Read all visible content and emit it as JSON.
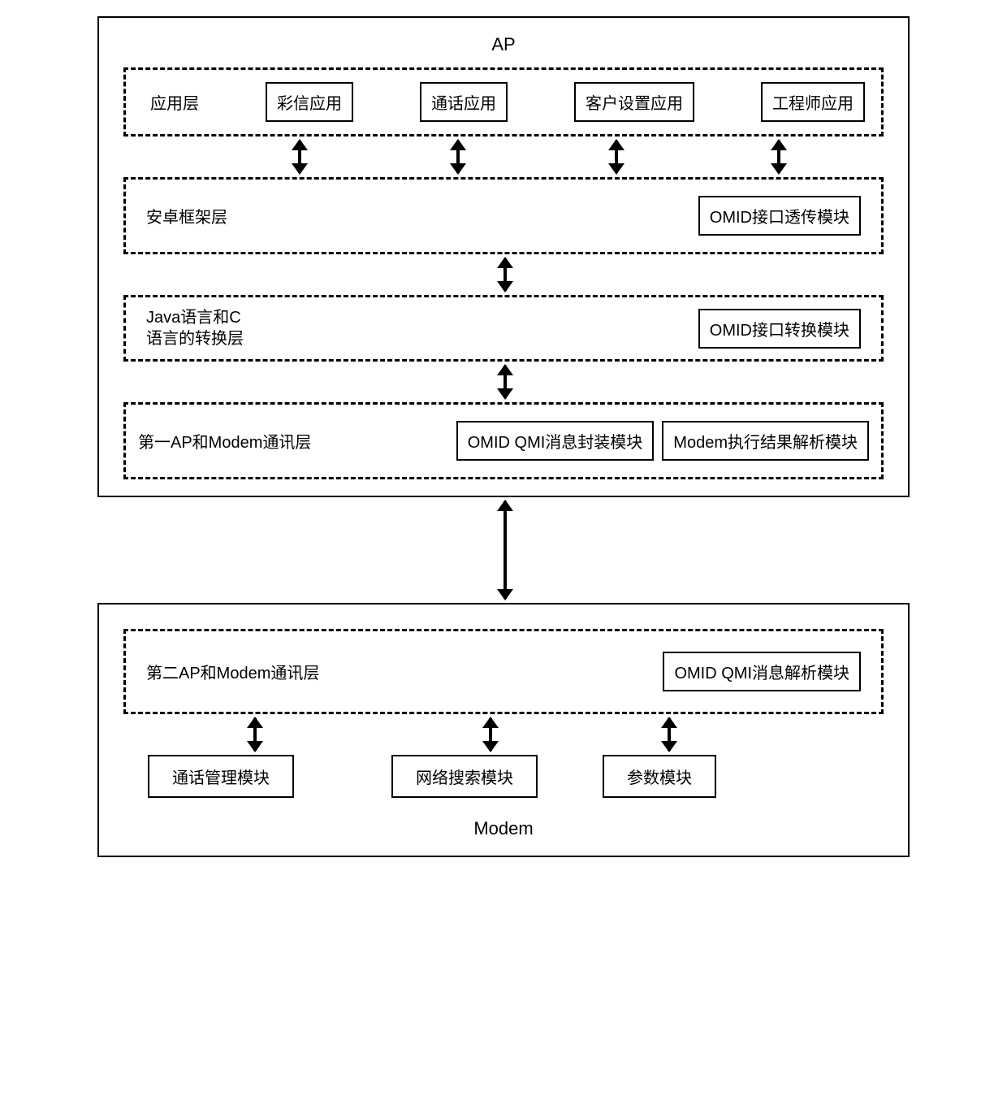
{
  "ap": {
    "title": "AP",
    "app_layer": {
      "label": "应用层",
      "mms_app": "彩信应用",
      "call_app": "通话应用",
      "customer_settings_app": "客户设置应用",
      "engineer_app": "工程师应用"
    },
    "android_framework": {
      "label": "安卓框架层",
      "omid_passthrough": "OMID接口透传模块"
    },
    "java_c_conversion": {
      "label_line1": "Java语言和C",
      "label_line2": "语言的转换层",
      "omid_conversion": "OMID接口转换模块"
    },
    "first_ap_modem_comm": {
      "label": "第一AP和Modem通讯层",
      "omid_qmi_encap": "OMID QMI消息封装模块",
      "modem_result_parse": "Modem执行结果解析模块"
    }
  },
  "modem": {
    "title": "Modem",
    "second_ap_modem_comm": {
      "label": "第二AP和Modem通讯层",
      "omid_qmi_parse": "OMID QMI消息解析模块"
    },
    "call_mgmt": "通话管理模块",
    "network_search": "网络搜索模块",
    "param_module": "参数模块"
  }
}
